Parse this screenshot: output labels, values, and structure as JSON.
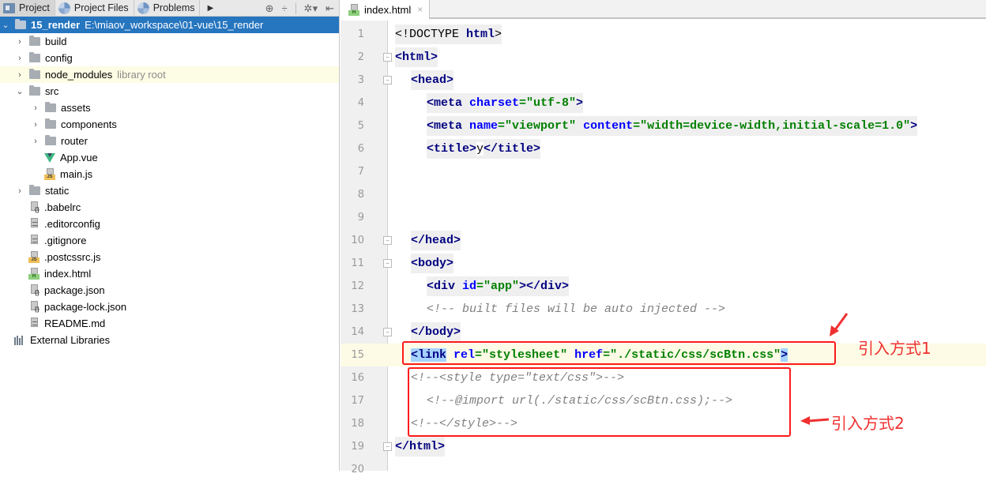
{
  "left_panel": {
    "tabs": [
      {
        "label": "Project",
        "icon": "project-icon",
        "active": true
      },
      {
        "label": "Project Files",
        "icon": "pie-icon",
        "active": false
      },
      {
        "label": "Problems",
        "icon": "pie-icon",
        "active": false
      }
    ],
    "more_icon": "play-right-icon",
    "tools": [
      "locate-icon",
      "collapse-icon",
      "gear-dropdown-icon",
      "hide-panel-icon"
    ],
    "tree": [
      {
        "label": "15_render",
        "path": "E:\\miaov_workspace\\01-vue\\15_render",
        "type": "folder",
        "expanded": true,
        "depth": 0,
        "selected": true
      },
      {
        "label": "build",
        "type": "folder",
        "expanded": false,
        "depth": 1
      },
      {
        "label": "config",
        "type": "folder",
        "expanded": false,
        "depth": 1
      },
      {
        "label": "node_modules",
        "suffix": "library root",
        "type": "folder",
        "expanded": false,
        "depth": 1,
        "highlight": true
      },
      {
        "label": "src",
        "type": "folder",
        "expanded": true,
        "depth": 1
      },
      {
        "label": "assets",
        "type": "folder",
        "expanded": false,
        "depth": 2
      },
      {
        "label": "components",
        "type": "folder",
        "expanded": false,
        "depth": 2
      },
      {
        "label": "router",
        "type": "folder",
        "expanded": false,
        "depth": 2
      },
      {
        "label": "App.vue",
        "type": "vue",
        "depth": 2
      },
      {
        "label": "main.js",
        "type": "js",
        "depth": 2
      },
      {
        "label": "static",
        "type": "folder",
        "expanded": false,
        "depth": 1
      },
      {
        "label": ".babelrc",
        "type": "json",
        "depth": 1
      },
      {
        "label": ".editorconfig",
        "type": "text",
        "depth": 1
      },
      {
        "label": ".gitignore",
        "type": "text",
        "depth": 1
      },
      {
        "label": ".postcssrc.js",
        "type": "js",
        "depth": 1
      },
      {
        "label": "index.html",
        "type": "html",
        "depth": 1
      },
      {
        "label": "package.json",
        "type": "json",
        "depth": 1
      },
      {
        "label": "package-lock.json",
        "type": "json",
        "depth": 1
      },
      {
        "label": "README.md",
        "type": "text",
        "depth": 1
      },
      {
        "label": "External Libraries",
        "type": "extlib",
        "depth": 0
      }
    ]
  },
  "editor": {
    "tab": {
      "label": "index.html",
      "close": "×"
    },
    "current_line": 15,
    "lines": [
      {
        "n": "1",
        "tokens": [
          [
            "doct",
            "<!DOCTYPE "
          ],
          [
            "tag",
            "html"
          ],
          [
            "doct",
            ">"
          ]
        ]
      },
      {
        "n": "2",
        "tokens": [
          [
            "tag",
            "<html>"
          ]
        ]
      },
      {
        "n": "3",
        "tokens": [
          [
            "tag",
            "<head>"
          ]
        ]
      },
      {
        "n": "4",
        "tokens": [
          [
            "tag",
            "<meta "
          ],
          [
            "attr",
            "charset"
          ],
          [
            "str",
            "=\"utf-8\""
          ],
          [
            "tag",
            ">"
          ]
        ]
      },
      {
        "n": "5",
        "tokens": [
          [
            "tag",
            "<meta "
          ],
          [
            "attr",
            "name"
          ],
          [
            "str",
            "=\"viewport\" "
          ],
          [
            "attr",
            "content"
          ],
          [
            "str",
            "=\"width=device-width,initial-scale=1.0\""
          ],
          [
            "tag",
            ">"
          ]
        ]
      },
      {
        "n": "6",
        "tokens": [
          [
            "tag",
            "<title>"
          ],
          [
            "txt",
            "y"
          ],
          [
            "tag",
            "</title>"
          ]
        ]
      },
      {
        "n": "7",
        "tokens": []
      },
      {
        "n": "8",
        "tokens": []
      },
      {
        "n": "9",
        "tokens": []
      },
      {
        "n": "10",
        "tokens": [
          [
            "tag",
            "</head>"
          ]
        ]
      },
      {
        "n": "11",
        "tokens": [
          [
            "tag",
            "<body>"
          ]
        ]
      },
      {
        "n": "12",
        "tokens": [
          [
            "tag",
            "<div "
          ],
          [
            "attr",
            "id"
          ],
          [
            "str",
            "=\"app\""
          ],
          [
            "tag",
            "></div>"
          ]
        ]
      },
      {
        "n": "13",
        "tokens": [
          [
            "cmt",
            "<!-- built files will be auto injected -->"
          ]
        ]
      },
      {
        "n": "14",
        "tokens": [
          [
            "tag",
            "</body>"
          ]
        ]
      },
      {
        "n": "15",
        "tokens": [
          [
            "tag",
            "<link"
          ],
          [
            "txt",
            " "
          ],
          [
            "attr",
            "rel"
          ],
          [
            "str",
            "=\"stylesheet\" "
          ],
          [
            "attr",
            "href"
          ],
          [
            "str",
            "=\"./static/css/scBtn.css\""
          ],
          [
            "tag",
            ">"
          ]
        ]
      },
      {
        "n": "16",
        "tokens": [
          [
            "cmt",
            "<!--<style type=\"text/css\">-->"
          ]
        ]
      },
      {
        "n": "17",
        "tokens": [
          [
            "cmt",
            "<!--@import url(./static/css/scBtn.css);-->"
          ]
        ]
      },
      {
        "n": "18",
        "tokens": [
          [
            "cmt",
            "<!--</style>-->"
          ]
        ]
      },
      {
        "n": "19",
        "tokens": [
          [
            "tag",
            "</html>"
          ]
        ]
      },
      {
        "n": "20",
        "tokens": []
      }
    ]
  },
  "annotations": {
    "method1": "引入方式1",
    "method2": "引入方式2",
    "color": "#f03030"
  }
}
